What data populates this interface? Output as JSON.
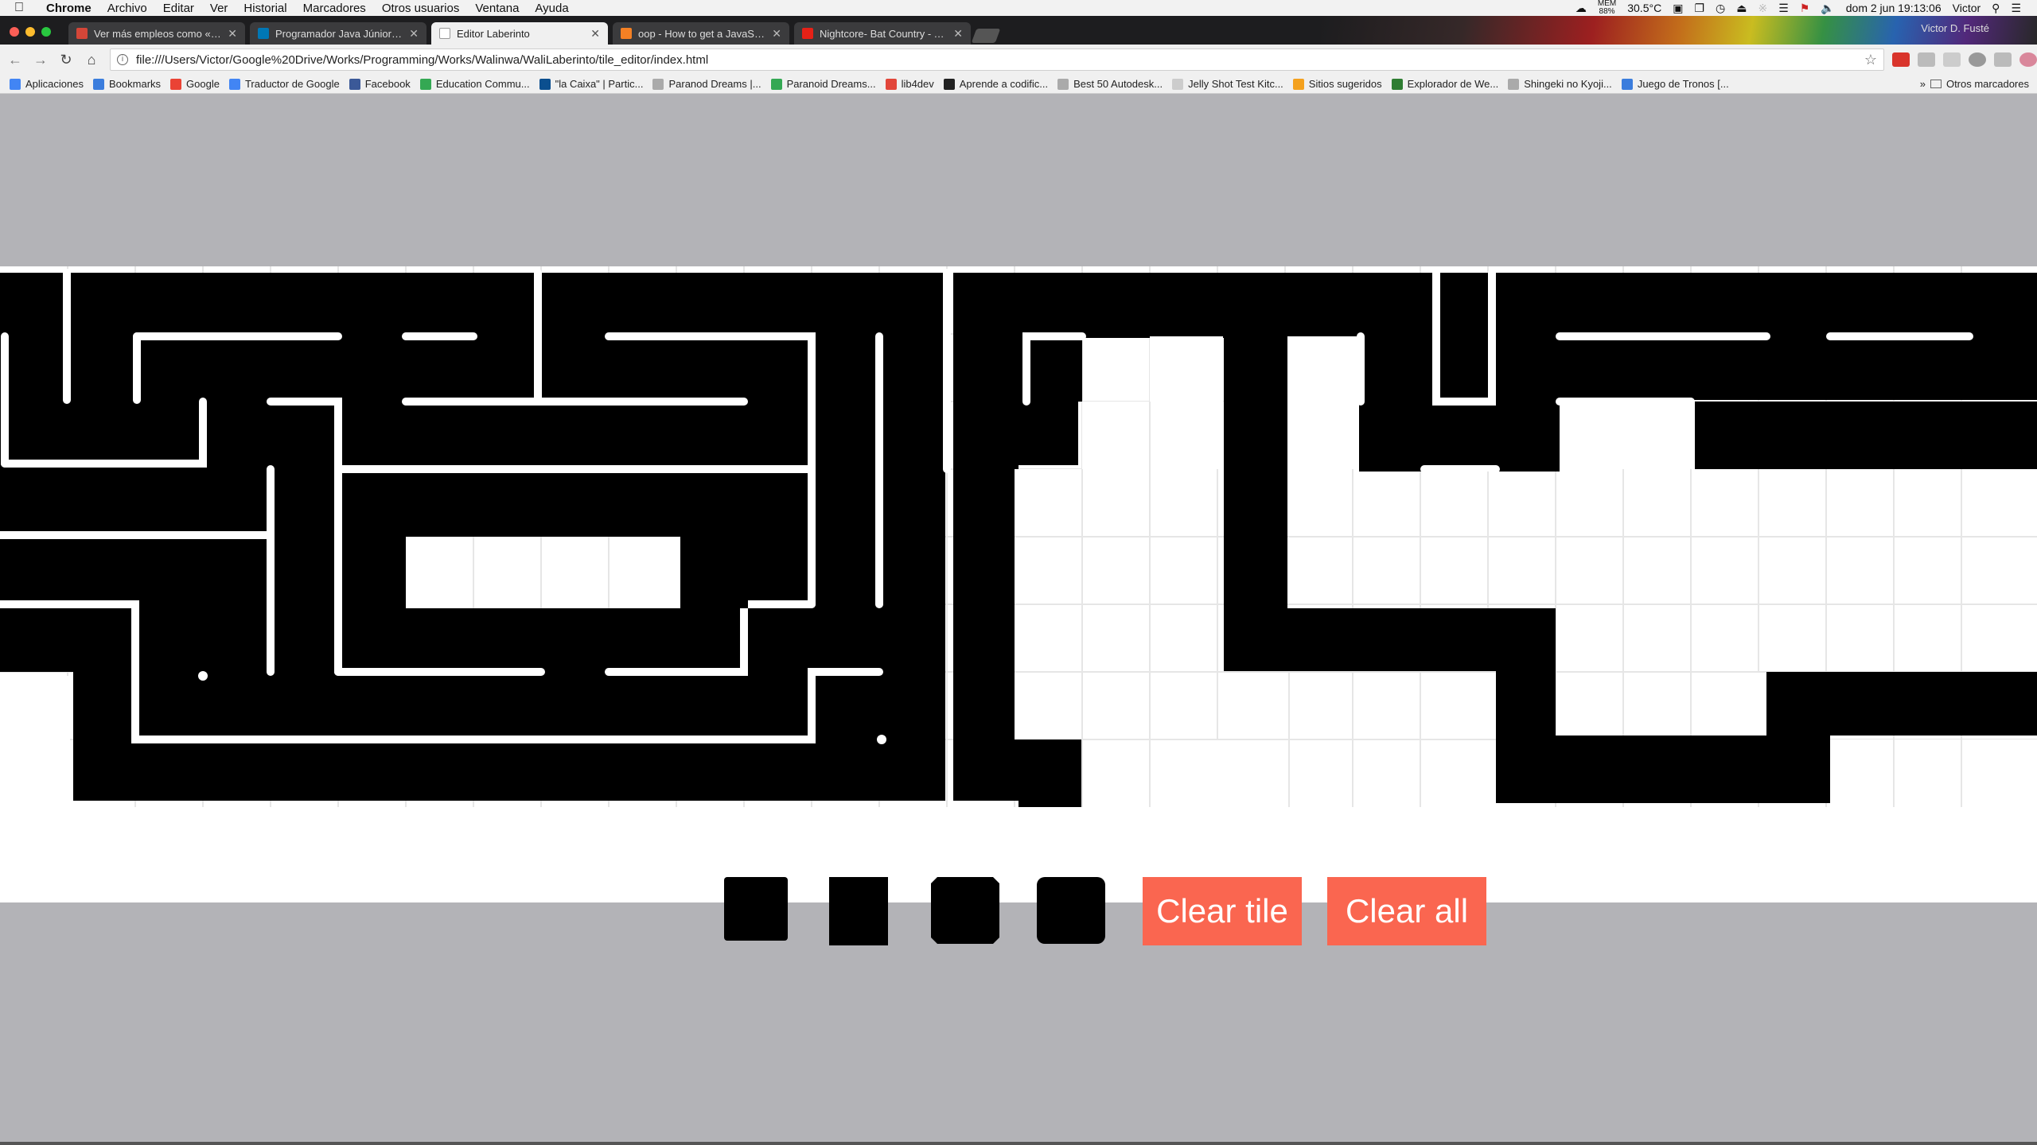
{
  "menubar": {
    "app": "Chrome",
    "items": [
      "Archivo",
      "Editar",
      "Ver",
      "Historial",
      "Marcadores",
      "Otros usuarios",
      "Ventana",
      "Ayuda"
    ],
    "mem_label": "MEM",
    "mem_value": "88%",
    "temperature": "30.5°C",
    "datetime": "dom 2 jun  19:13:06",
    "user": "Victor"
  },
  "browser": {
    "profile_name": "Victor D. Fusté",
    "tabs": [
      {
        "title": "Ver más empleos como «Java",
        "favicon_color": "#d44638",
        "active": false
      },
      {
        "title": "Programador Java Júnior – Sa",
        "favicon_color": "#0077b5",
        "active": false
      },
      {
        "title": "Editor Laberinto",
        "favicon_color": "#999999",
        "active": true
      },
      {
        "title": "oop - How to get a JavaScrip",
        "favicon_color": "#f48024",
        "active": false
      },
      {
        "title": "Nightcore- Bat Country - You",
        "favicon_color": "#e62117",
        "active": false
      }
    ],
    "url": "file:///Users/Victor/Google%20Drive/Works/Programming/Works/Walinwa/WaliLaberinto/tile_editor/index.html",
    "bookmarks": [
      {
        "label": "Aplicaciones",
        "color": "#4285f4"
      },
      {
        "label": "Bookmarks",
        "color": "#3b7ddd"
      },
      {
        "label": "Google",
        "color": "#ea4335"
      },
      {
        "label": "Traductor de Google",
        "color": "#4285f4"
      },
      {
        "label": "Facebook",
        "color": "#3b5998"
      },
      {
        "label": "Education Commu...",
        "color": "#34a853"
      },
      {
        "label": "\"la Caixa\" | Partic...",
        "color": "#0b4f8f"
      },
      {
        "label": "Paranod Dreams |...",
        "color": "#aaaaaa"
      },
      {
        "label": "Paranoid Dreams...",
        "color": "#34a853"
      },
      {
        "label": "lib4dev",
        "color": "#e2463a"
      },
      {
        "label": "Aprende a codific...",
        "color": "#222222"
      },
      {
        "label": "Best 50 Autodesk...",
        "color": "#aaaaaa"
      },
      {
        "label": "Jelly Shot Test Kitc...",
        "color": "#cccccc"
      },
      {
        "label": "Sitios sugeridos",
        "color": "#f4a11e"
      },
      {
        "label": "Explorador de We...",
        "color": "#2e7d32"
      },
      {
        "label": "Shingeki no Kyoji...",
        "color": "#aaaaaa"
      },
      {
        "label": "Juego de Tronos [...",
        "color": "#3b7ddd"
      }
    ],
    "other_bookmarks": "Otros marcadores",
    "more_chevron": "»"
  },
  "editor": {
    "buttons": {
      "clear_tile": "Clear tile",
      "clear_all": "Clear all"
    },
    "colors": {
      "wall": "#000000",
      "floor": "#ffffff",
      "grid": "#e6e6e6",
      "page_bg": "#b3b3b7",
      "button": "#fa6650"
    },
    "palette": [
      "tile-square",
      "tile-rect",
      "tile-notched",
      "tile-rounded"
    ]
  }
}
